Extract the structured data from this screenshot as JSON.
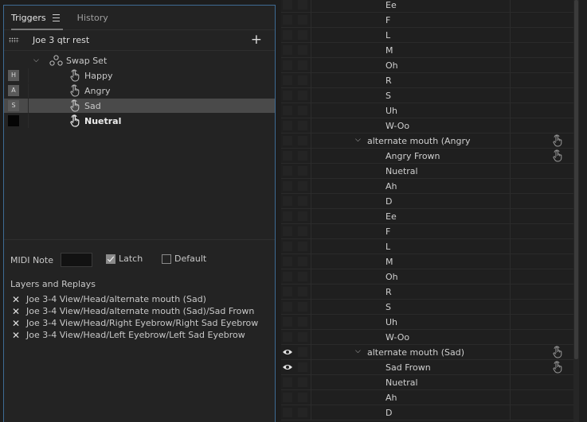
{
  "tabs": {
    "triggers": "Triggers",
    "history": "History"
  },
  "puppet": {
    "name": "Joe 3 qtr rest"
  },
  "swap_set": {
    "label": "Swap Set"
  },
  "triggers": [
    {
      "key": "H",
      "label": "Happy",
      "selected": false
    },
    {
      "key": "A",
      "label": "Angry",
      "selected": false
    },
    {
      "key": "S",
      "label": "Sad",
      "selected": true
    },
    {
      "key": "",
      "label": "Nuetral",
      "selected": false
    }
  ],
  "midi": {
    "label": "MIDI Note",
    "value": ""
  },
  "latch": {
    "label": "Latch",
    "checked": true
  },
  "default": {
    "label": "Default",
    "checked": false
  },
  "layers": {
    "title": "Layers and Replays",
    "items": [
      "Joe 3-4 View/Head/alternate mouth (Sad)",
      "Joe 3-4 View/Head/alternate mouth (Sad)/Sad Frown",
      "Joe 3-4 View/Head/Right Eyebrow/Right Sad Eyebrow",
      "Joe 3-4 View/Head/Left Eyebrow/Left Sad Eyebrow"
    ]
  },
  "right_rows": [
    {
      "label": "Ee",
      "type": "item",
      "eye": false,
      "hand": false
    },
    {
      "label": "F",
      "type": "item",
      "eye": false,
      "hand": false
    },
    {
      "label": "L",
      "type": "item",
      "eye": false,
      "hand": false
    },
    {
      "label": "M",
      "type": "item",
      "eye": false,
      "hand": false
    },
    {
      "label": "Oh",
      "type": "item",
      "eye": false,
      "hand": false
    },
    {
      "label": "R",
      "type": "item",
      "eye": false,
      "hand": false
    },
    {
      "label": "S",
      "type": "item",
      "eye": false,
      "hand": false
    },
    {
      "label": "Uh",
      "type": "item",
      "eye": false,
      "hand": false
    },
    {
      "label": "W-Oo",
      "type": "item",
      "eye": false,
      "hand": false
    },
    {
      "label": "alternate mouth (Angry",
      "type": "group",
      "eye": false,
      "hand": true
    },
    {
      "label": "Angry Frown",
      "type": "item",
      "eye": false,
      "hand": true
    },
    {
      "label": "Nuetral",
      "type": "item",
      "eye": false,
      "hand": false
    },
    {
      "label": "Ah",
      "type": "item",
      "eye": false,
      "hand": false
    },
    {
      "label": "D",
      "type": "item",
      "eye": false,
      "hand": false
    },
    {
      "label": "Ee",
      "type": "item",
      "eye": false,
      "hand": false
    },
    {
      "label": "F",
      "type": "item",
      "eye": false,
      "hand": false
    },
    {
      "label": "L",
      "type": "item",
      "eye": false,
      "hand": false
    },
    {
      "label": "M",
      "type": "item",
      "eye": false,
      "hand": false
    },
    {
      "label": "Oh",
      "type": "item",
      "eye": false,
      "hand": false
    },
    {
      "label": "R",
      "type": "item",
      "eye": false,
      "hand": false
    },
    {
      "label": "S",
      "type": "item",
      "eye": false,
      "hand": false
    },
    {
      "label": "Uh",
      "type": "item",
      "eye": false,
      "hand": false
    },
    {
      "label": "W-Oo",
      "type": "item",
      "eye": false,
      "hand": false
    },
    {
      "label": "alternate mouth (Sad)",
      "type": "group",
      "eye": true,
      "hand": true
    },
    {
      "label": "Sad Frown",
      "type": "item",
      "eye": true,
      "hand": true
    },
    {
      "label": "Nuetral",
      "type": "item",
      "eye": false,
      "hand": false
    },
    {
      "label": "Ah",
      "type": "item",
      "eye": false,
      "hand": false
    },
    {
      "label": "D",
      "type": "item",
      "eye": false,
      "hand": false
    }
  ],
  "icons": {
    "grid": "puppet-grid-icon",
    "add": "plus-icon",
    "chevron": "chevron-down-icon",
    "swap": "swap-set-icon",
    "hand": "hand-trigger-icon",
    "eye": "eye-icon",
    "remove": "close-icon",
    "menu": "hamburger-menu-icon"
  },
  "colors": {
    "panel_border": "#3e6b94",
    "selected_row": "#4a4a4a"
  }
}
